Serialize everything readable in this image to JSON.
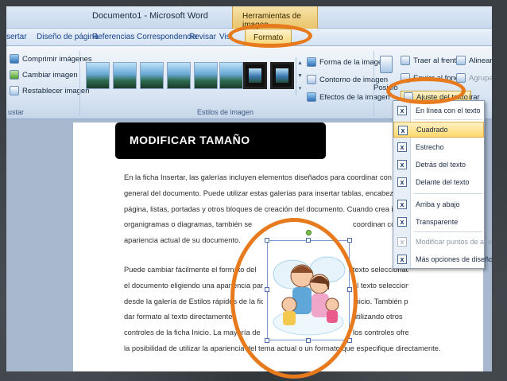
{
  "window": {
    "title": "Documento1 - Microsoft Word",
    "contextual_tab": "Herramientas de imagen"
  },
  "tabs": [
    {
      "label": "sertar"
    },
    {
      "label": "Diseño de página"
    },
    {
      "label": "Referencias"
    },
    {
      "label": "Correspondencia"
    },
    {
      "label": "Revisar"
    },
    {
      "label": "Vist"
    },
    {
      "label": "Formato",
      "active": true
    }
  ],
  "ribbon": {
    "adjust": {
      "items": [
        "Comprimir imágenes",
        "Cambiar imagen",
        "Restablecer imagen"
      ],
      "group_label": "ustar"
    },
    "styles": {
      "group_label": "Estilos de imagen",
      "options": [
        "Forma de la imagen",
        "Contorno de imagen",
        "Efectos de la imagen"
      ]
    },
    "arrange": {
      "position_label": "Posició",
      "bring_front": "Traer al frente",
      "send_back": "Enviar al fondo",
      "wrap_text": "Ajuste del texto",
      "align": "Alinear",
      "group": "Agrupar",
      "rotate": "irar"
    }
  },
  "wrap_menu": {
    "items": [
      {
        "label": "En línea con el texto"
      },
      {
        "label": "Cuadrado",
        "highlighted": true
      },
      {
        "label": "Estrecho"
      },
      {
        "label": "Detrás del texto"
      },
      {
        "label": "Delante del texto"
      },
      {
        "label": "Arriba y abajo"
      },
      {
        "label": "Transparente"
      },
      {
        "label": "Modificar puntos de ajuste",
        "disabled": true
      },
      {
        "label": "Más opciones de diseño..."
      }
    ]
  },
  "document": {
    "para1_left": [
      "En la ficha Insertar, las galerías incluyen elementos diseñados para coordinar con la apariencia",
      "general del documento. Puede utilizar estas galerías para insertar tablas, encabezados, pies de",
      "página, listas, portadas y otros bloques de creación del documento. Cuando crea imágenes,",
      "organigramas o diagramas, también se",
      "apariencia actual de su documento."
    ],
    "para1_right": [
      "",
      "",
      "",
      "coordinan con la",
      ""
    ],
    "para2_left": [
      "Puede cambiar fácilmente el formato del",
      "el documento eligiendo una apariencia para",
      "desde la galería de Estilos rápidos de la ficha",
      "dar formato al texto directamente",
      "controles de la ficha Inicio. La mayoría de",
      "la posibilidad de utilizar la apariencia del tema actual o un formato que especifique directamente."
    ],
    "para2_right": [
      "texto seleccionado en",
      "el texto seleccionado",
      "Inicio. También puede",
      "utilizando otros",
      "los controles ofrecen",
      ""
    ]
  },
  "banner": {
    "text": "MODIFICAR TAMAÑO"
  },
  "colors": {
    "highlight": "#e87a1e",
    "banner_bg": "#000000",
    "menu_highlight": "#ffd86b"
  }
}
